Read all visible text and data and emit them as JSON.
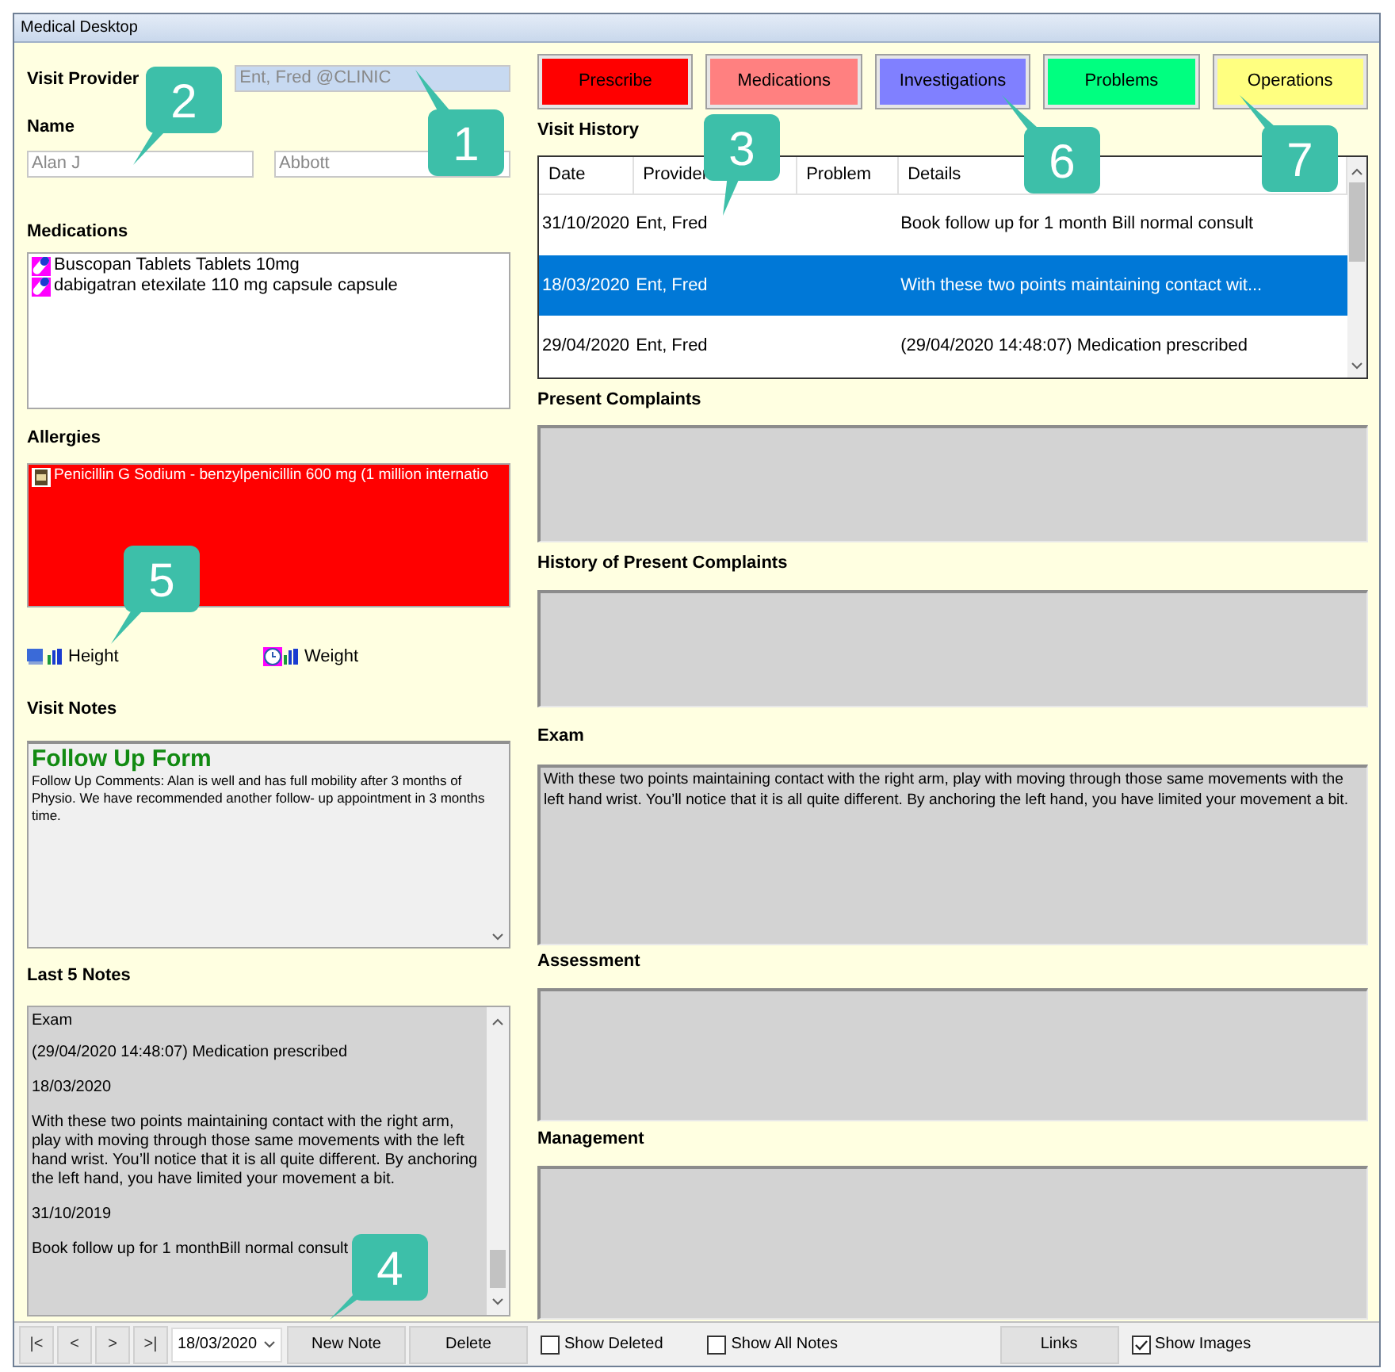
{
  "window": {
    "title": "Medical Desktop"
  },
  "visit_provider": {
    "label": "Visit Provider",
    "value": "Ent, Fred @CLINIC"
  },
  "name": {
    "label": "Name",
    "first": "Alan J",
    "last": "Abbott"
  },
  "medications": {
    "label": "Medications",
    "items": [
      "Buscopan Tablets Tablets 10mg",
      "dabigatran etexilate 110 mg capsule capsule"
    ]
  },
  "allergies": {
    "label": "Allergies",
    "items": [
      "Penicillin G Sodium - benzylpenicillin 600 mg (1 million internatio"
    ]
  },
  "measurements": [
    {
      "kind": "height",
      "label": "Height"
    },
    {
      "kind": "weight",
      "label": "Weight"
    }
  ],
  "visit_notes": {
    "label": "Visit Notes",
    "form_title": "Follow Up Form",
    "text": "Follow Up Comments: Alan is well and has full mobility after 3 months of Physio. We have recommended another follow- up appointment in 3 months time."
  },
  "last_notes": {
    "label": "Last 5 Notes",
    "entries": [
      "Exam",
      "(29/04/2020 14:48:07) Medication prescribed",
      "18/03/2020",
      "With these two points maintaining contact with the right arm, play with moving through those same movements with the left hand wrist. You’ll notice that it is all quite different. By anchoring the left hand, you have limited your movement a bit.",
      "31/10/2019",
      "Book follow up for 1 monthBill normal consult"
    ]
  },
  "action_buttons": [
    {
      "label": "Prescribe",
      "color": "#ff0000"
    },
    {
      "label": "Medications",
      "color": "#ff8080"
    },
    {
      "label": "Investigations",
      "color": "#8080ff"
    },
    {
      "label": "Problems",
      "color": "#00ff80"
    },
    {
      "label": "Operations",
      "color": "#ffff80"
    }
  ],
  "visit_history": {
    "label": "Visit History",
    "columns": [
      "Date",
      "Provider",
      "Problem",
      "Details"
    ],
    "rows": [
      {
        "cells": [
          "31/10/2020",
          "Ent, Fred",
          "",
          "Book follow up for 1 month Bill normal consult"
        ],
        "selected": false
      },
      {
        "cells": [
          "18/03/2020",
          "Ent, Fred",
          "",
          "With these two points maintaining contact wit..."
        ],
        "selected": true
      },
      {
        "cells": [
          "29/04/2020",
          "Ent, Fred",
          "",
          "(29/04/2020 14:48:07) Medication prescribed"
        ],
        "selected": false
      }
    ]
  },
  "sections": [
    {
      "label": "Present Complaints"
    },
    {
      "label": "History of Present Complaints"
    },
    {
      "label": "Exam",
      "text": "With these two points maintaining contact with the right arm, play with moving through those same movements with the left hand wrist. You’ll notice that it is all quite different. By anchoring the left hand, you have limited your movement a bit."
    },
    {
      "label": "Assessment"
    },
    {
      "label": "Management"
    }
  ],
  "toolbar": [
    {
      "kind": "nav",
      "label": "|<"
    },
    {
      "kind": "nav",
      "label": "<"
    },
    {
      "kind": "nav",
      "label": ">"
    },
    {
      "kind": "nav",
      "label": ">|"
    },
    {
      "kind": "date",
      "value": "18/03/2020"
    },
    {
      "kind": "button",
      "label": "New Note"
    },
    {
      "kind": "button",
      "label": "Delete"
    },
    {
      "kind": "checkbox",
      "label": "Show Deleted",
      "checked": false
    },
    {
      "kind": "checkbox",
      "label": "Show All Notes",
      "checked": false
    },
    {
      "kind": "button",
      "label": "Links"
    },
    {
      "kind": "checkbox",
      "label": "Show Images",
      "checked": true
    }
  ],
  "callouts": [
    {
      "label": "1"
    },
    {
      "label": "2"
    },
    {
      "label": "3"
    },
    {
      "label": "4"
    },
    {
      "label": "5"
    },
    {
      "label": "6"
    },
    {
      "label": "7"
    }
  ]
}
